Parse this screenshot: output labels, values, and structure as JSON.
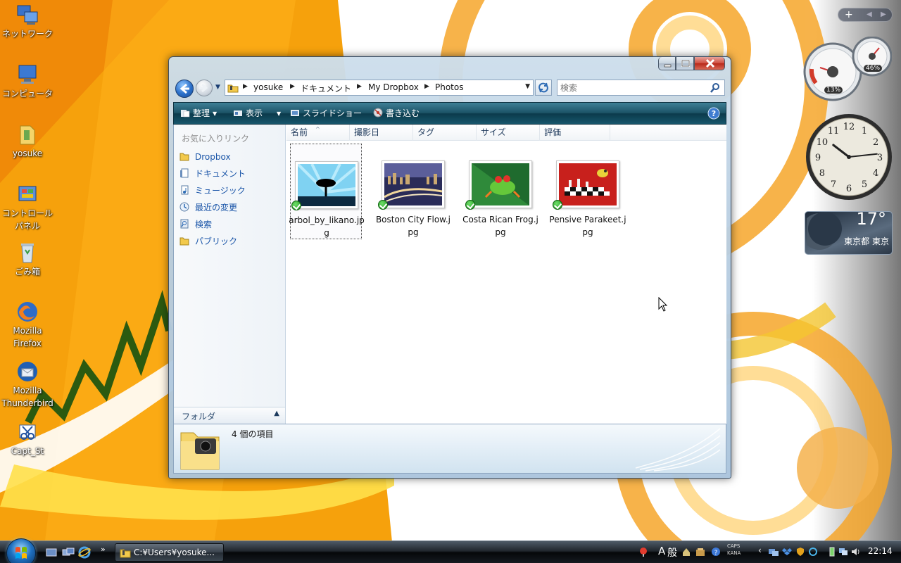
{
  "desktop": {
    "icons": [
      {
        "label": "ネットワーク"
      },
      {
        "label": "コンピュータ"
      },
      {
        "label": "yosuke"
      },
      {
        "label": "コントロール パネル"
      },
      {
        "label": "ごみ箱"
      },
      {
        "label": "Mozilla Firefox"
      },
      {
        "label": "Mozilla Thunderbird"
      },
      {
        "label": "Capt_St"
      }
    ]
  },
  "gadgets": {
    "cpu_percent": "13%",
    "mem_percent": "46%",
    "clock_numbers": [
      "12",
      "1",
      "2",
      "3",
      "4",
      "5",
      "6",
      "7",
      "8",
      "9",
      "10",
      "11"
    ],
    "clock_hour_value": 10.25,
    "clock_minute_value": 14,
    "weather_temp": "17°",
    "weather_location": "東京都 東京"
  },
  "window": {
    "address": {
      "crumbs": [
        "yosuke",
        "ドキュメント",
        "My Dropbox",
        "Photos"
      ]
    },
    "search": {
      "placeholder": "検索"
    },
    "command_bar": {
      "organize": "整理",
      "views": "表示",
      "slideshow": "スライドショー",
      "burn": "書き込む"
    },
    "nav_pane": {
      "favorites_header": "お気に入りリンク",
      "items": [
        "Dropbox",
        "ドキュメント",
        "ミュージック",
        "最近の変更",
        "検索",
        "パブリック"
      ],
      "folders_label": "フォルダ"
    },
    "columns": [
      "名前",
      "撮影日",
      "タグ",
      "サイズ",
      "評価"
    ],
    "files": [
      {
        "name": "arbol_by_likano.jpg"
      },
      {
        "name": "Boston City Flow.jpg"
      },
      {
        "name": "Costa Rican Frog.jpg"
      },
      {
        "name": "Pensive Parakeet.jpg"
      }
    ],
    "details": {
      "count": "4 個の項目"
    }
  },
  "taskbar": {
    "task_button": "C:¥Users¥yosuke...",
    "ime_mode": "A",
    "ime_label": "般",
    "caps": "CAPS",
    "kana": "KANA",
    "clock": "22:14"
  },
  "colors": {
    "accent_orange": "#f6a10c",
    "command_bar": "#1c5367",
    "link_blue": "#1a55a8"
  }
}
